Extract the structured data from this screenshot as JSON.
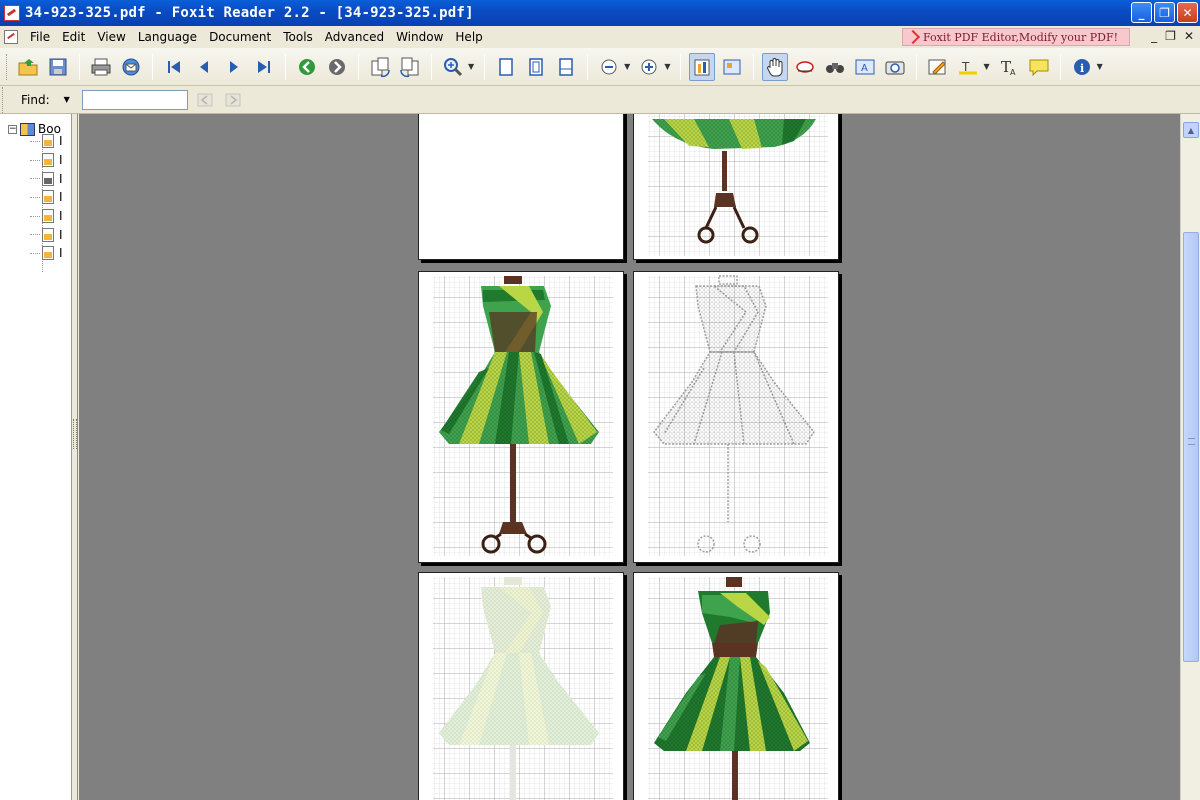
{
  "window": {
    "title": "34-923-325.pdf - Foxit Reader 2.2 - [34-923-325.pdf]",
    "controls": [
      "_",
      "❐",
      "✕"
    ]
  },
  "menu": {
    "items": [
      "File",
      "Edit",
      "View",
      "Language",
      "Document",
      "Tools",
      "Advanced",
      "Window",
      "Help"
    ],
    "ad_text": "Foxit PDF Editor,Modify your PDF!",
    "doc_controls": [
      "_",
      "❐",
      "✕"
    ]
  },
  "toolbar": {
    "icons": [
      "open-icon",
      "save-icon",
      "print-icon",
      "email-icon",
      "first-page-icon",
      "prev-page-icon",
      "next-page-icon",
      "last-page-icon",
      "go-back-icon",
      "go-forward-icon",
      "rotate-left-icon",
      "rotate-right-icon",
      "zoom-in-icon",
      "single-page-icon",
      "continuous-icon",
      "facing-icon",
      "zoom-out-icon",
      "zoom-plus-icon",
      "bookmarks-panel-icon",
      "thumbnails-icon",
      "hand-tool-icon",
      "select-text-icon",
      "find-binoculars-icon",
      "typewriter-icon",
      "snapshot-icon",
      "pencil-icon",
      "highlight-icon",
      "text-tool-icon",
      "comment-icon",
      "info-icon"
    ]
  },
  "find": {
    "label": "Find:",
    "value": ""
  },
  "bookmarks": {
    "root_label": "Boo",
    "children": [
      "I",
      "I",
      "I",
      "I",
      "I",
      "I",
      "I"
    ]
  },
  "colors": {
    "viewer_bg": "#808080",
    "title_bar": "#0a5fd8",
    "dress_dark": "#1f7a2e",
    "dress_mid": "#3fa34d",
    "dress_light": "#b8d645",
    "stand": "#5a3323"
  }
}
